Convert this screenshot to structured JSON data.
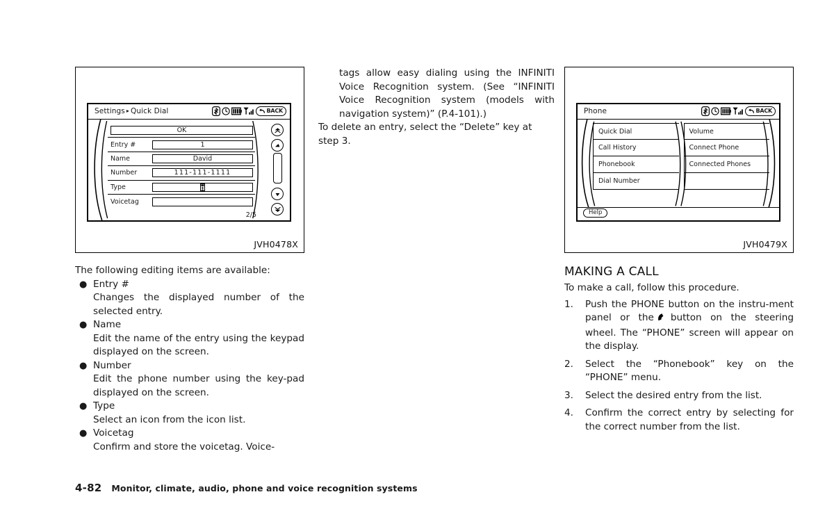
{
  "figures": {
    "left": {
      "code": "JVH0478X",
      "screen": {
        "title_root": "Settings",
        "title_sep": "▸",
        "title_leaf": "Quick Dial",
        "status_icons": [
          "bluetooth-icon",
          "clock-icon",
          "battery-icon",
          "signal-icon"
        ],
        "back_label": "BACK",
        "ok_label": "OK",
        "rows": [
          {
            "label": "Entry #",
            "value": "1"
          },
          {
            "label": "Name",
            "value": "David"
          },
          {
            "label": "Number",
            "value": "111-111-1111"
          },
          {
            "label": "Type",
            "value": ""
          },
          {
            "label": "Voicetag",
            "value": ""
          }
        ],
        "pager": "2/5",
        "scroll_buttons": [
          "scroll-top-button",
          "scroll-up-button",
          "scroll-down-button",
          "scroll-bottom-button"
        ]
      }
    },
    "right": {
      "code": "JVH0479X",
      "screen": {
        "title": "Phone",
        "status_icons": [
          "bluetooth-icon",
          "clock-icon",
          "battery-icon",
          "signal-icon"
        ],
        "back_label": "BACK",
        "menu_left": [
          "Quick Dial",
          "Call History",
          "Phonebook",
          "Dial Number"
        ],
        "menu_right": [
          "Volume",
          "Connect Phone",
          "Connected Phones"
        ],
        "help_label": "Help"
      }
    }
  },
  "left_column": {
    "intro": "The following editing items are available:",
    "bullets": [
      {
        "marker": "●",
        "term": "Entry #",
        "desc": "Changes the displayed number of the selected entry."
      },
      {
        "marker": "●",
        "term": "Name",
        "desc": "Edit the name of the entry using the keypad displayed on the screen."
      },
      {
        "marker": "●",
        "term": "Number",
        "desc": "Edit the phone number using the key-pad displayed on the screen."
      },
      {
        "marker": "●",
        "term": "Type",
        "desc": "Select an icon from the icon list."
      },
      {
        "marker": "●",
        "term": "Voicetag",
        "desc": "Confirm and store the voicetag. Voice-"
      }
    ]
  },
  "mid_column": {
    "continued_paragraph": "tags allow easy dialing using the INFINITI Voice Recognition system. (See “INFINITI Voice Recognition system (models with navigation system)” (P.4-101).)",
    "delete_paragraph": "To delete an entry, select the “Delete” key at step 3."
  },
  "right_column": {
    "heading": "MAKING A CALL",
    "lead": "To make a call, follow this procedure.",
    "steps": [
      {
        "num": "1.",
        "text_before": "Push the PHONE button on the instru-ment panel or the",
        "icon": "phone-handset-icon",
        "text_after": "button on the steering wheel. The “PHONE” screen will appear on the display."
      },
      {
        "num": "2.",
        "text": "Select the “Phonebook” key on the “PHONE” menu."
      },
      {
        "num": "3.",
        "text": "Select the desired entry from the list."
      },
      {
        "num": "4.",
        "text": "Confirm the correct entry by selecting for the correct number from the list."
      }
    ]
  },
  "footer": {
    "page_number": "4-82",
    "section_title": "Monitor, climate, audio, phone and voice recognition systems"
  }
}
